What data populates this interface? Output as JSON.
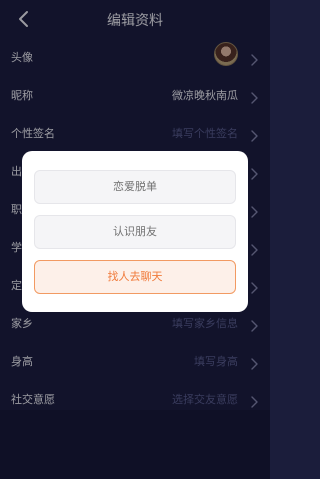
{
  "header": {
    "title": "编辑资料"
  },
  "rows": [
    {
      "label": "头像",
      "value": "",
      "placeholder": false
    },
    {
      "label": "昵称",
      "value": "微凉晚秋南瓜",
      "placeholder": false
    },
    {
      "label": "个性签名",
      "value": "填写个性签名",
      "placeholder": true
    },
    {
      "label": "出",
      "value": "",
      "placeholder": true
    },
    {
      "label": "职",
      "value": "",
      "placeholder": true
    },
    {
      "label": "学",
      "value": "",
      "placeholder": true
    },
    {
      "label": "定",
      "value": "",
      "placeholder": true
    },
    {
      "label": "家乡",
      "value": "填写家乡信息",
      "placeholder": true
    },
    {
      "label": "身高",
      "value": "填写身高",
      "placeholder": true
    },
    {
      "label": "社交意愿",
      "value": "选择交友意愿",
      "placeholder": true
    }
  ],
  "modal": {
    "options": [
      "恋爱脱单",
      "认识朋友",
      "找人去聊天"
    ]
  },
  "colors": {
    "background": "#1b1d3b",
    "accent": "#f07a3a",
    "placeholder_text": "#5e6290",
    "value_text": "#ffffff"
  }
}
